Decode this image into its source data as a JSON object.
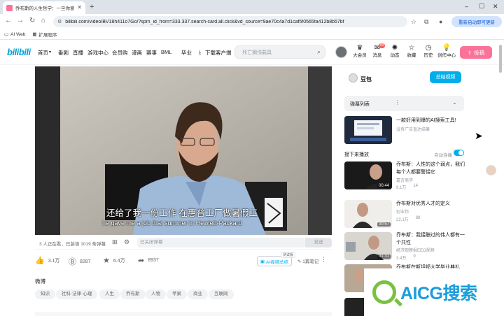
{
  "browser": {
    "tab_title": "乔布斯的人生哲学：一旦你意识",
    "url": "bilibili.com/video/BV18h411o7Go/?spm_id_from=333.337.search-card.all.click&vd_source=9ae70c4a7d1caf5f0565fa412b8b57bf",
    "relaunch_label": "重新启动即可更新",
    "bookmarks": [
      "AI Web",
      "扩展程序"
    ]
  },
  "header": {
    "logo": "bilibili",
    "nav": [
      "首页",
      "番剧",
      "直播",
      "游戏中心",
      "会员购",
      "漫画",
      "赛事",
      "BML",
      "毕业",
      "下载客户端"
    ],
    "search_placeholder": "死亡搁浅载具",
    "icons": [
      {
        "label": "大会员",
        "icon": "vip-icon"
      },
      {
        "label": "消息",
        "icon": "message-icon",
        "badge": "99"
      },
      {
        "label": "动态",
        "icon": "dynamic-icon"
      },
      {
        "label": "收藏",
        "icon": "favorite-icon"
      },
      {
        "label": "历史",
        "icon": "history-icon"
      },
      {
        "label": "创作中心",
        "icon": "creator-icon"
      }
    ],
    "upload_label": "投稿"
  },
  "video": {
    "subtitle_cn": "还给了我一份工作 在惠普工厂做暑假工",
    "subtitle_en": "he gave me a job that summer in Hewlett-Packard",
    "viewers": "3 人正在看，已装填 1019 条弹幕",
    "danmaku_placeholder": "已关闭弹幕",
    "send_label": "发送"
  },
  "actions": {
    "like": "3.1万",
    "coin": "8287",
    "favorite": "6.4万",
    "share": "8937",
    "ai_summary": "AI视频总结",
    "ai_tag": "测试版",
    "notes": "1篇笔记"
  },
  "section_title": "微博",
  "tags": [
    "知识",
    "社科·法律·心理",
    "人生",
    "乔布斯",
    "人物",
    "苹果",
    "商业",
    "互联网"
  ],
  "sidebar": {
    "up_name": "豆包",
    "follow_label": "总结视频",
    "danmaku_list_label": "弹幕列表",
    "ad": {
      "title": "一款好用到爆的AI搜索工具!",
      "sub": "没有广告直达结果"
    },
    "next_label": "接下来播放",
    "autoplay_label": "自动连播",
    "videos": [
      {
        "title": "乔布斯：人性的这个弱点，我们每个人都要警惕它",
        "up": "嘉言商学",
        "views": "9.1万",
        "danmaku": "14",
        "duration": "00:44"
      },
      {
        "title": "乔布斯对优秀人才的定义",
        "up": "创业邦",
        "views": "22.1万",
        "danmaku": "88",
        "duration": "00:57"
      },
      {
        "title": "乔布斯：我接触过的伟人都有一个共性",
        "up": "经济观察报EEO视频",
        "views": "3.4万",
        "danmaku": "9",
        "duration": "01:31"
      },
      {
        "title": "乔布斯在斯坦福大学毕业典礼",
        "up": "",
        "views": "",
        "danmaku": "",
        "duration": ""
      }
    ]
  },
  "watermark": "AICG搜索"
}
